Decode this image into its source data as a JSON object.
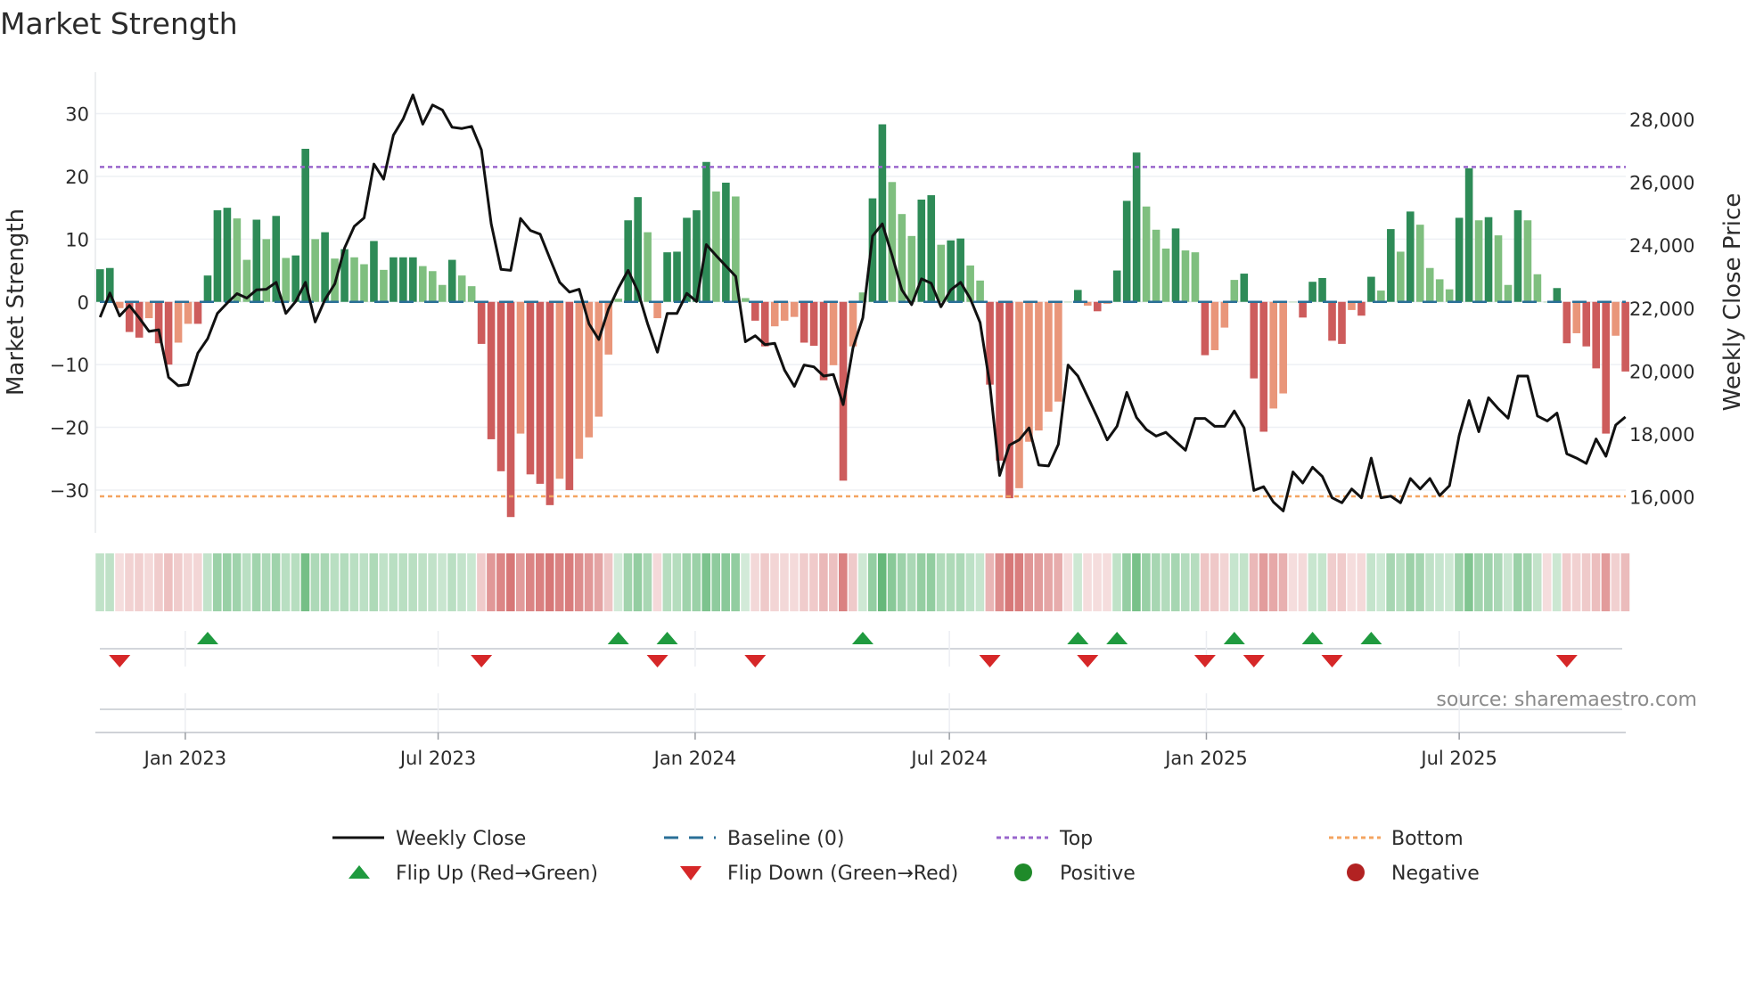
{
  "title": "Market Strength",
  "source": "source: sharemaestro.com",
  "colors": {
    "pos_strong": "#2e8b57",
    "pos_weak": "#7fbf7f",
    "neg_strong": "#cd5c5c",
    "neg_weak": "#e9967a",
    "top_line": "#9966cc",
    "bottom_line": "#f4a460",
    "baseline": "#2a6f97",
    "close_line": "#111111",
    "flip_up": "#1f9a3f",
    "flip_down": "#d62728",
    "positive": "#1f8a2a",
    "negative": "#b22222"
  },
  "legend": [
    {
      "label": "Weekly Close",
      "icon": "solid-line"
    },
    {
      "label": "Baseline (0)",
      "icon": "dashed-line"
    },
    {
      "label": "Top",
      "icon": "dotted-line"
    },
    {
      "label": "Bottom",
      "icon": "dotted-line"
    },
    {
      "label": "Flip Up (Red→Green)",
      "icon": "triangle-up"
    },
    {
      "label": "Flip Down (Green→Red)",
      "icon": "triangle-down"
    },
    {
      "label": "Positive",
      "icon": "circle"
    },
    {
      "label": "Negative",
      "icon": "circle"
    }
  ],
  "chart_data": {
    "type": "bar",
    "title": "Market Strength",
    "ylabel": "Market Strength",
    "y2label": "Weekly Close Price",
    "frequency": "weekly",
    "start_date": "2022-11-01",
    "ylim": [
      -36,
      36
    ],
    "y2lim": [
      15000,
      29000
    ],
    "yticks": [
      30,
      20,
      10,
      0,
      -10,
      -20,
      -30
    ],
    "ytick_labels": [
      "30",
      "20",
      "10",
      "0",
      "−10",
      "−20",
      "−30"
    ],
    "y2ticks": [
      28000,
      26000,
      24000,
      22000,
      20000,
      18000,
      16000
    ],
    "y2tick_labels": [
      "28,000",
      "26,000",
      "24,000",
      "22,000",
      "20,000",
      "18,000",
      "16,000"
    ],
    "xticks": [
      {
        "date": "2023-01-01",
        "label": "Jan 2023"
      },
      {
        "date": "2023-07-01",
        "label": "Jul 2023"
      },
      {
        "date": "2024-01-01",
        "label": "Jan 2024"
      },
      {
        "date": "2024-07-01",
        "label": "Jul 2024"
      },
      {
        "date": "2025-01-01",
        "label": "Jan 2025"
      },
      {
        "date": "2025-07-01",
        "label": "Jul 2025"
      }
    ],
    "top_level": 21.5,
    "bottom_level": -31,
    "baseline": 0,
    "grid": true,
    "legend_position": "bottom",
    "strength": [
      5.2,
      5.4,
      -1,
      -4.8,
      -5.7,
      -2.6,
      -6.6,
      -10,
      -6.5,
      -3.5,
      -3.5,
      4.2,
      14.6,
      15,
      13.3,
      6.7,
      13.1,
      10,
      13.7,
      7,
      7.4,
      24.4,
      10,
      11.1,
      6.9,
      8.4,
      7.1,
      6,
      9.7,
      5.1,
      7.1,
      7.1,
      7.1,
      5.7,
      4.9,
      2.7,
      6.7,
      4.2,
      2.5,
      -6.7,
      -21.9,
      -27,
      -34.3,
      -21,
      -27.5,
      -29,
      -32.4,
      -28.2,
      -30,
      -25,
      -21.6,
      -18.3,
      -8.4,
      0.5,
      13,
      16.7,
      11.1,
      -2.6,
      7.9,
      8,
      13.4,
      14.6,
      22.3,
      17.6,
      19,
      16.8,
      0.6,
      -3,
      -7.1,
      -3.9,
      -3,
      -2.4,
      -6.5,
      -7,
      -12.5,
      -10.1,
      -28.5,
      -7.1,
      1.5,
      16.5,
      28.3,
      19.1,
      14,
      10.5,
      16.3,
      17,
      9.1,
      9.8,
      10.1,
      5.8,
      3.4,
      -13.2,
      -25.3,
      -31.3,
      -29.7,
      -22.3,
      -20.5,
      -17.5,
      -15.9,
      0,
      1.9,
      -0.6,
      -1.5,
      -0.3,
      5,
      16.1,
      23.8,
      15.2,
      11.5,
      8.5,
      11.7,
      8.2,
      7.9,
      -8.5,
      -7.7,
      -4.1,
      3.5,
      4.5,
      -12.2,
      -20.7,
      -17,
      -14.6,
      0,
      -2.5,
      3.2,
      3.8,
      -6.2,
      -6.7,
      -1.3,
      -2.2,
      4,
      1.8,
      11.6,
      8,
      14.4,
      12.3,
      5.4,
      3.6,
      2,
      13.4,
      21.3,
      13,
      13.5,
      10.6,
      2.7,
      14.6,
      13,
      4.4,
      0,
      2.2,
      -6.6,
      -5,
      -7.1,
      -10.6,
      -21,
      -5.4,
      -11.1
    ],
    "weekly_close": [
      21710,
      22480,
      21750,
      22080,
      21690,
      21260,
      21310,
      19800,
      19530,
      19570,
      20570,
      21030,
      21830,
      22160,
      22460,
      22320,
      22580,
      22600,
      22820,
      21830,
      22210,
      22820,
      21560,
      22270,
      22770,
      23910,
      24600,
      24870,
      26580,
      26100,
      27500,
      28020,
      28780,
      27850,
      28460,
      28300,
      27750,
      27710,
      27780,
      27030,
      24680,
      23230,
      23200,
      24850,
      24470,
      24350,
      23580,
      22820,
      22510,
      22600,
      21500,
      21000,
      21970,
      22630,
      23200,
      22540,
      21500,
      20600,
      21830,
      21830,
      22470,
      22210,
      24020,
      23670,
      23340,
      23010,
      20930,
      21120,
      20840,
      20880,
      20030,
      19510,
      20190,
      20130,
      19840,
      19890,
      18930,
      20740,
      21690,
      24290,
      24680,
      23670,
      22580,
      22110,
      22930,
      22790,
      22040,
      22580,
      22820,
      22300,
      21540,
      19560,
      16680,
      17640,
      17810,
      18190,
      17010,
      16980,
      17670,
      20190,
      19840,
      19180,
      18520,
      17810,
      18240,
      19320,
      18520,
      18140,
      17930,
      18050,
      17760,
      17480,
      18490,
      18490,
      18240,
      18240,
      18730,
      18190,
      16200,
      16320,
      15830,
      15550,
      16790,
      16440,
      16940,
      16650,
      15970,
      15810,
      16250,
      15970,
      17230,
      15970,
      16020,
      15810,
      16580,
      16250,
      16580,
      16040,
      16350,
      17950,
      19060,
      18070,
      19150,
      18800,
      18500,
      19840,
      19840,
      18570,
      18410,
      18660,
      17370,
      17230,
      17060,
      17840,
      17290,
      18280,
      18540
    ],
    "flip_up_weeks": [
      12,
      54,
      59,
      79,
      101,
      105,
      117,
      125,
      131
    ],
    "flip_down_weeks": [
      3,
      40,
      58,
      68,
      92,
      102,
      114,
      119,
      127,
      151
    ]
  }
}
